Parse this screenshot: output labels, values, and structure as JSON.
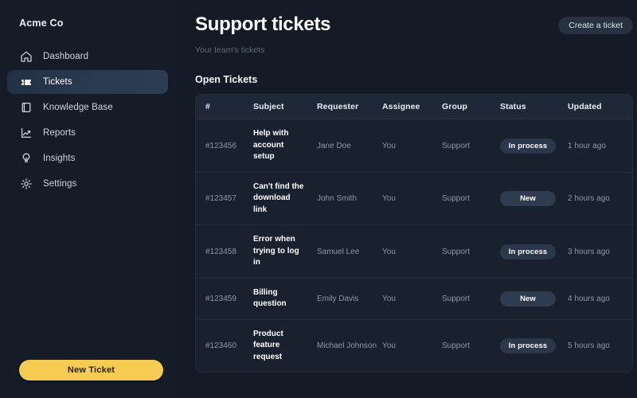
{
  "sidebar": {
    "brand": "Acme Co",
    "items": [
      {
        "label": "Dashboard",
        "icon": "home-icon",
        "active": false
      },
      {
        "label": "Tickets",
        "icon": "ticket-icon",
        "active": true
      },
      {
        "label": "Knowledge Base",
        "icon": "book-icon",
        "active": false
      },
      {
        "label": "Reports",
        "icon": "chart-line-icon",
        "active": false
      },
      {
        "label": "Insights",
        "icon": "lightbulb-icon",
        "active": false
      },
      {
        "label": "Settings",
        "icon": "gear-icon",
        "active": false
      }
    ],
    "new_ticket_label": "New Ticket"
  },
  "header": {
    "title": "Support tickets",
    "subtitle": "Your team's tickets",
    "create_label": "Create a ticket"
  },
  "section": {
    "title": "Open Tickets"
  },
  "table": {
    "columns": [
      "#",
      "Subject",
      "Requester",
      "Assignee",
      "Group",
      "Status",
      "Updated"
    ],
    "rows": [
      {
        "id": "#123456",
        "subject": "Help with account setup",
        "requester": "Jane Doe",
        "assignee": "You",
        "group": "Support",
        "status": "In process",
        "status_kind": "inprocess",
        "updated": "1 hour ago"
      },
      {
        "id": "#123457",
        "subject": "Can't find the download link",
        "requester": "John Smith",
        "assignee": "You",
        "group": "Support",
        "status": "New",
        "status_kind": "new",
        "updated": "2 hours ago"
      },
      {
        "id": "#123458",
        "subject": "Error when trying to log in",
        "requester": "Samuel Lee",
        "assignee": "You",
        "group": "Support",
        "status": "In process",
        "status_kind": "inprocess",
        "updated": "3 hours ago"
      },
      {
        "id": "#123459",
        "subject": "Billing question",
        "requester": "Emily Davis",
        "assignee": "You",
        "group": "Support",
        "status": "New",
        "status_kind": "new",
        "updated": "4 hours ago"
      },
      {
        "id": "#123460",
        "subject": "Product feature request",
        "requester": "Michael Johnson",
        "assignee": "You",
        "group": "Support",
        "status": "In process",
        "status_kind": "inprocess",
        "updated": "5 hours ago"
      }
    ]
  },
  "colors": {
    "background": "#141b26",
    "sidebar": "#151c27",
    "card": "#19212e",
    "accent_yellow": "#f5cb52",
    "badge_inprocess": "#2b374a",
    "badge_new": "#2f3b4e",
    "active_nav": "#2a3a50"
  }
}
